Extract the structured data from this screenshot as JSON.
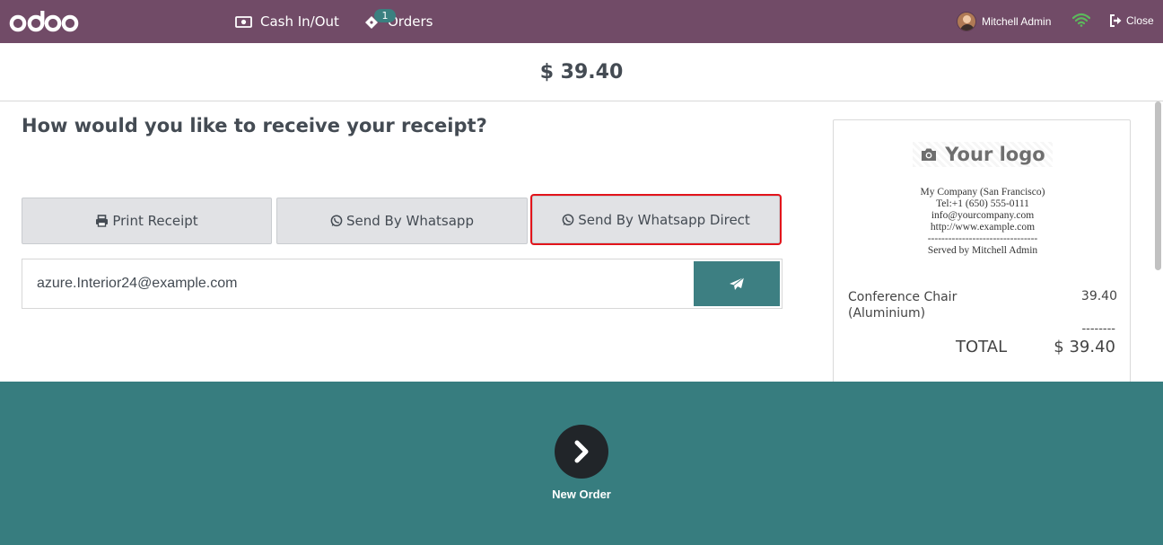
{
  "navbar": {
    "brand": "odoo",
    "cash_label": "Cash In/Out",
    "orders_label": "Orders",
    "orders_badge": "1",
    "user_name": "Mitchell Admin",
    "close_label": "Close",
    "colors": {
      "bar": "#714b67",
      "badge": "#3a8080",
      "wifi": "#5cb85c"
    }
  },
  "payment": {
    "amount": "$ 39.40"
  },
  "receipt_options": {
    "question": "How would you like to receive your receipt?",
    "print_label": "Print Receipt",
    "whatsapp_label": "Send By Whatsapp",
    "whatsapp_direct_label": "Send By Whatsapp Direct",
    "email_value": "azure.Interior24@example.com"
  },
  "receipt": {
    "logo_text": "Your logo",
    "company": "My Company (San Francisco)",
    "tel": "Tel:+1 (650) 555-0111",
    "email": "info@yourcompany.com",
    "website": "http://www.example.com",
    "separator": "--------------------------------",
    "served_by": "Served by Mitchell Admin",
    "line_product": "Conference Chair (Aluminium)",
    "line_price": "39.40",
    "subtotal_dashes": "--------",
    "total_label": "TOTAL",
    "total_value": "$ 39.40"
  },
  "footer": {
    "next_label": "New Order",
    "color": "#377d7f"
  }
}
